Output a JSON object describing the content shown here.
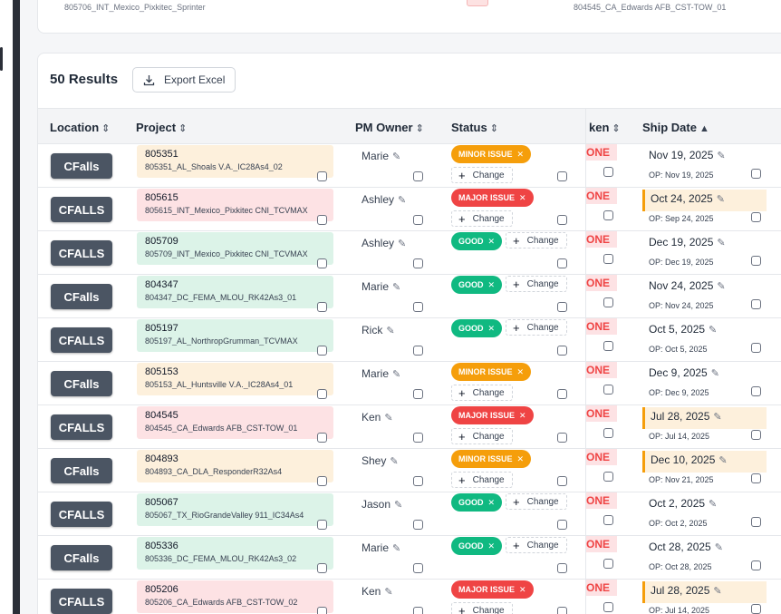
{
  "top_row": {
    "project_name": "805706_INT_Mexico_Pixkitec_Sprinter",
    "other": "804545_CA_Edwards AFB_CST-TOW_01"
  },
  "results_label": "50 Results",
  "export_label": "Export Excel",
  "columns": {
    "location": "Location",
    "project": "Project",
    "pm_owner": "PM Owner",
    "status": "Status",
    "taken": "ken",
    "ship_date": "Ship Date"
  },
  "sort_icons": {
    "unsorted": "⌃⌄",
    "asc": "^"
  },
  "change_label": "Change",
  "taken_value": "ONE",
  "rows": [
    {
      "location": "CFalls",
      "project_num": "805351",
      "project_name": "805351_AL_Shoals V.A._IC28As4_02",
      "project_color": "orange",
      "owner": "Marie",
      "status": "MINOR ISSUE",
      "status_color": "orange",
      "ship": "Nov 19, 2025",
      "ship_hl": false,
      "op": "OP: Nov 19, 2025"
    },
    {
      "location": "CFALLS",
      "project_num": "805615",
      "project_name": "805615_INT_Mexico_Pixkitec CNI_TCVMAX",
      "project_color": "red",
      "owner": "Ashley",
      "status": "MAJOR ISSUE",
      "status_color": "red",
      "ship": "Oct 24, 2025",
      "ship_hl": true,
      "op": "OP: Sep 24, 2025"
    },
    {
      "location": "CFALLS",
      "project_num": "805709",
      "project_name": "805709_INT_Mexico_Pixkitec CNI_TCVMAX",
      "project_color": "green",
      "owner": "Ashley",
      "status": "GOOD",
      "status_color": "green",
      "ship": "Dec 19, 2025",
      "ship_hl": false,
      "op": "OP: Dec 19, 2025"
    },
    {
      "location": "CFalls",
      "project_num": "804347",
      "project_name": "804347_DC_FEMA_MLOU_RK42As3_01",
      "project_color": "green",
      "owner": "Marie",
      "status": "GOOD",
      "status_color": "green",
      "ship": "Nov 24, 2025",
      "ship_hl": false,
      "op": "OP: Nov 24, 2025"
    },
    {
      "location": "CFALLS",
      "project_num": "805197",
      "project_name": "805197_AL_NorthropGrumman_TCVMAX",
      "project_color": "green",
      "owner": "Rick",
      "status": "GOOD",
      "status_color": "green",
      "ship": "Oct 5, 2025",
      "ship_hl": false,
      "op": "OP: Oct 5, 2025"
    },
    {
      "location": "CFalls",
      "project_num": "805153",
      "project_name": "805153_AL_Huntsville V.A._IC28As4_01",
      "project_color": "orange",
      "owner": "Marie",
      "status": "MINOR ISSUE",
      "status_color": "orange",
      "ship": "Dec 9, 2025",
      "ship_hl": false,
      "op": "OP: Dec 9, 2025"
    },
    {
      "location": "CFALLS",
      "project_num": "804545",
      "project_name": "804545_CA_Edwards AFB_CST-TOW_01",
      "project_color": "red",
      "owner": "Ken",
      "status": "MAJOR ISSUE",
      "status_color": "red",
      "ship": "Jul 28, 2025",
      "ship_hl": true,
      "op": "OP: Jul 14, 2025"
    },
    {
      "location": "CFalls",
      "project_num": "804893",
      "project_name": "804893_CA_DLA_ResponderR32As4",
      "project_color": "orange",
      "owner": "Shey",
      "status": "MINOR ISSUE",
      "status_color": "orange",
      "ship": "Dec 10, 2025",
      "ship_hl": true,
      "op": "OP: Nov 21, 2025"
    },
    {
      "location": "CFALLS",
      "project_num": "805067",
      "project_name": "805067_TX_RioGrandeValley 911_IC34As4",
      "project_color": "green",
      "owner": "Jason",
      "status": "GOOD",
      "status_color": "green",
      "ship": "Oct 2, 2025",
      "ship_hl": false,
      "op": "OP: Oct 2, 2025"
    },
    {
      "location": "CFalls",
      "project_num": "805336",
      "project_name": "805336_DC_FEMA_MLOU_RK42As3_02",
      "project_color": "green",
      "owner": "Marie",
      "status": "GOOD",
      "status_color": "green",
      "ship": "Oct 28, 2025",
      "ship_hl": false,
      "op": "OP: Oct 28, 2025"
    },
    {
      "location": "CFALLS",
      "project_num": "805206",
      "project_name": "805206_CA_Edwards AFB_CST-TOW_02",
      "project_color": "red",
      "owner": "Ken",
      "status": "MAJOR ISSUE",
      "status_color": "red",
      "ship": "Jul 28, 2025",
      "ship_hl": true,
      "op": "OP: Jul 14, 2025"
    }
  ],
  "icons": {
    "pencil": "pencil-icon",
    "download": "download-icon",
    "plus": "plus-icon",
    "close": "close-icon",
    "checkbox": "checkbox-icon"
  }
}
